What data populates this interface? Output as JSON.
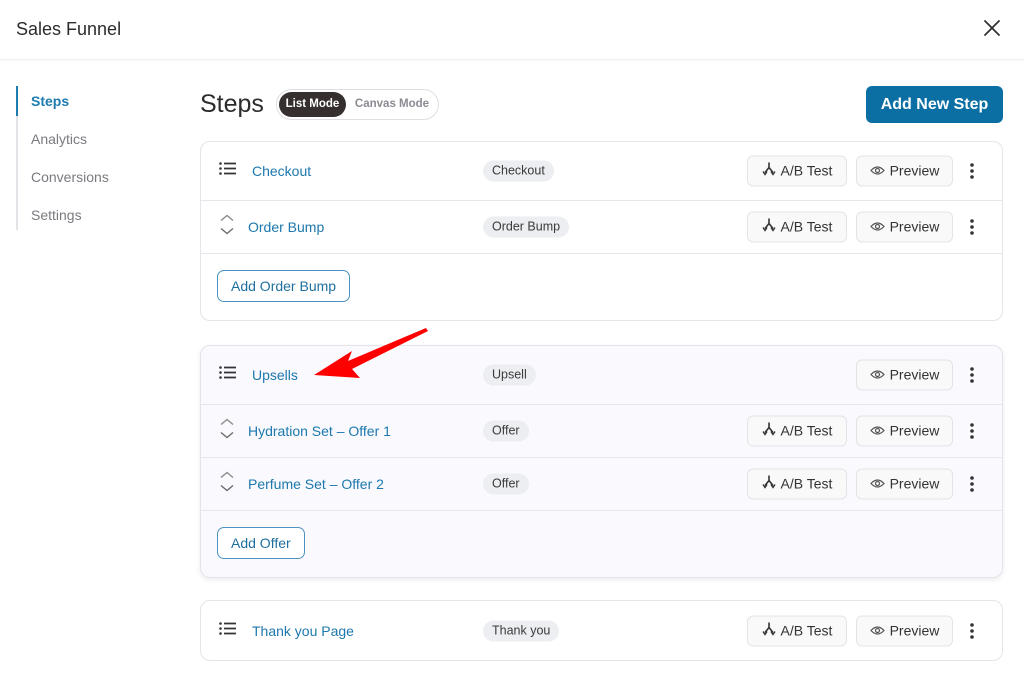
{
  "header": {
    "title": "Sales Funnel",
    "close_icon": "close-icon"
  },
  "sidebar": {
    "items": [
      {
        "label": "Steps",
        "active": true
      },
      {
        "label": "Analytics",
        "active": false
      },
      {
        "label": "Conversions",
        "active": false
      },
      {
        "label": "Settings",
        "active": false
      }
    ]
  },
  "main": {
    "title": "Steps",
    "modes": {
      "list": "List Mode",
      "canvas": "Canvas Mode",
      "selected": "List Mode"
    },
    "add_step_label": "Add New Step",
    "ab_label": "A/B Test",
    "preview_label": "Preview",
    "groups": [
      {
        "rows": [
          {
            "name": "Checkout",
            "badge": "Checkout",
            "icon": "list-icon",
            "ab": true
          },
          {
            "name": "Order Bump",
            "badge": "Order Bump",
            "icon": "reorder-icon",
            "ab": true
          }
        ],
        "footer_button": "Add Order Bump"
      },
      {
        "rows": [
          {
            "name": "Upsells",
            "badge": "Upsell",
            "icon": "list-icon",
            "ab": false
          },
          {
            "name": "Hydration Set – Offer 1",
            "badge": "Offer",
            "icon": "reorder-icon",
            "ab": true
          },
          {
            "name": "Perfume Set – Offer 2",
            "badge": "Offer",
            "icon": "reorder-icon",
            "ab": true
          }
        ],
        "footer_button": "Add Offer"
      },
      {
        "rows": [
          {
            "name": "Thank you Page",
            "badge": "Thank you",
            "icon": "list-icon",
            "ab": true
          }
        ]
      }
    ]
  },
  "annotation": {
    "type": "red-arrow",
    "points_to": "Upsells"
  },
  "colors": {
    "accent": "#0b6fa4",
    "link": "#1c78ad",
    "annotation": "#ff0000"
  }
}
